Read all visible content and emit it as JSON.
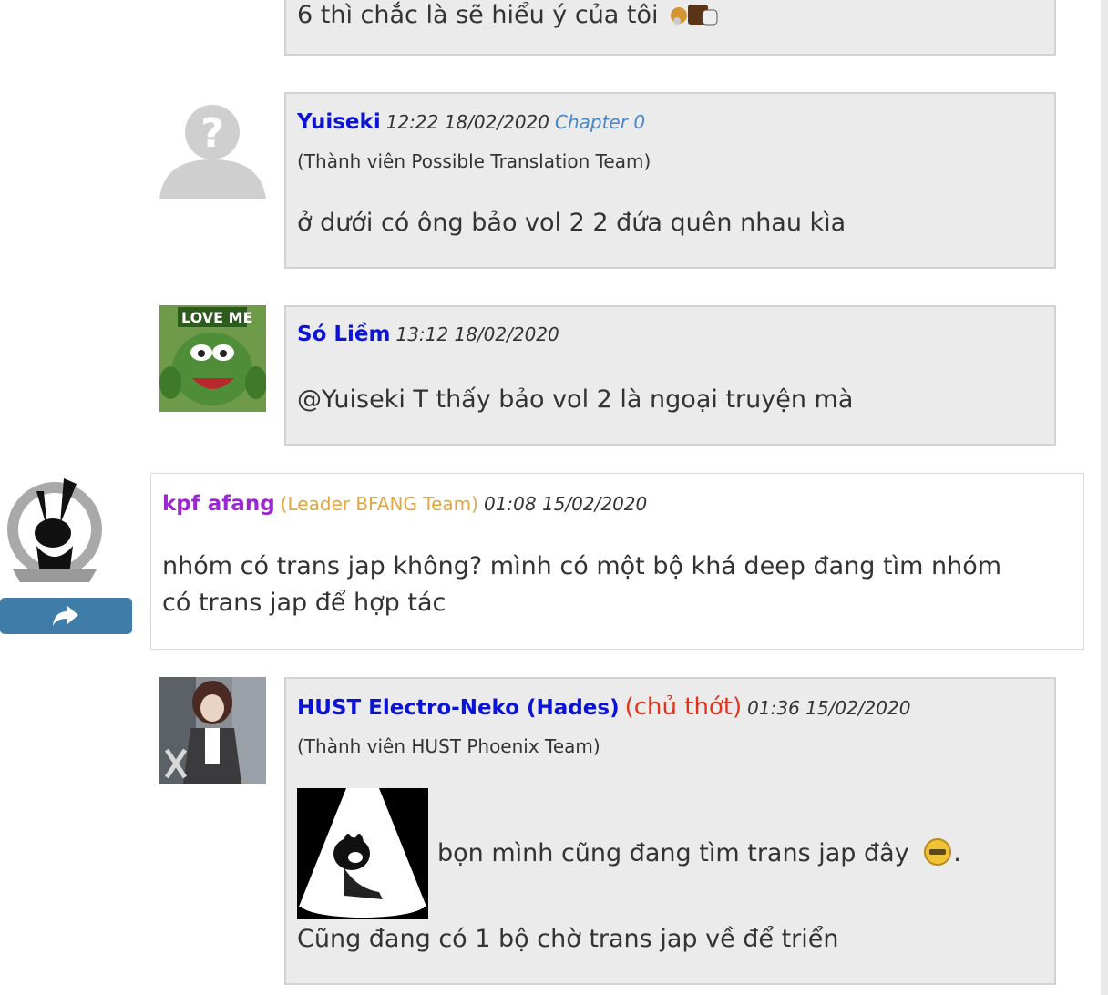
{
  "comments": [
    {
      "body": "6 thì chắc là sẽ hiểu ý của tôi"
    },
    {
      "username": "Yuiseki",
      "time": "12:22 18/02/2020",
      "chapter": "Chapter 0",
      "member": "(Thành viên Possible Translation Team)",
      "body": "ở dưới có ông bảo vol 2 2 đứa quên nhau kìa"
    },
    {
      "username": "Só Liềm",
      "time": "13:12 18/02/2020",
      "body": "@Yuiseki T thấy bảo vol 2 là ngoại truyện mà",
      "avatar_text": "LOVE ME"
    },
    {
      "username": "kpf afang",
      "team": "(Leader BFANG Team)",
      "time": "01:08 15/02/2020",
      "body_line1": "nhóm có trans jap không? mình có một bộ khá deep đang tìm nhóm",
      "body_line2": "có trans jap để hợp tác"
    },
    {
      "username": "HUST Electro-Neko (Hades)",
      "owner": "(chủ thớt)",
      "time": "01:36 15/02/2020",
      "member": "(Thành viên HUST Phoenix Team)",
      "body_line1": "bọn mình cũng đang tìm trans jap đây",
      "body_line1_end": ".",
      "body_line2": "Cũng đang có 1 bộ chờ trans jap về để triển"
    }
  ],
  "colors": {
    "username": "#0b14d6",
    "leader": "#9b27d3",
    "team": "#e2a540",
    "owner": "#e2321b",
    "chapter": "#4a86c8",
    "share_button": "#3f7da8"
  }
}
